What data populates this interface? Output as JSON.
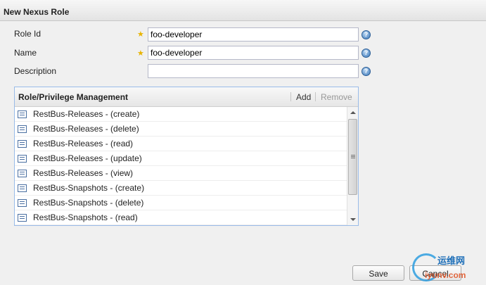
{
  "panel": {
    "title": "New Nexus Role"
  },
  "form": {
    "role_id": {
      "label": "Role Id",
      "value": "foo-developer",
      "required": true
    },
    "name": {
      "label": "Name",
      "value": "foo-developer",
      "required": true
    },
    "description": {
      "label": "Description",
      "value": "",
      "required": false
    },
    "required_marker": "★",
    "help_icon": "?"
  },
  "privileges": {
    "title": "Role/Privilege Management",
    "add_label": "Add",
    "remove_label": "Remove",
    "items": [
      {
        "label": "RestBus-Releases - (create)"
      },
      {
        "label": "RestBus-Releases - (delete)"
      },
      {
        "label": "RestBus-Releases - (read)"
      },
      {
        "label": "RestBus-Releases - (update)"
      },
      {
        "label": "RestBus-Releases - (view)"
      },
      {
        "label": "RestBus-Snapshots - (create)"
      },
      {
        "label": "RestBus-Snapshots - (delete)"
      },
      {
        "label": "RestBus-Snapshots - (read)"
      }
    ]
  },
  "buttons": {
    "save": "Save",
    "cancel": "Cancel"
  },
  "watermark": {
    "text1": "运维网",
    "text2": "iyunv.com"
  },
  "colors": {
    "accent": "#3c78b9",
    "grid_border": "#99bbe8",
    "required_star": "#e8b400"
  }
}
